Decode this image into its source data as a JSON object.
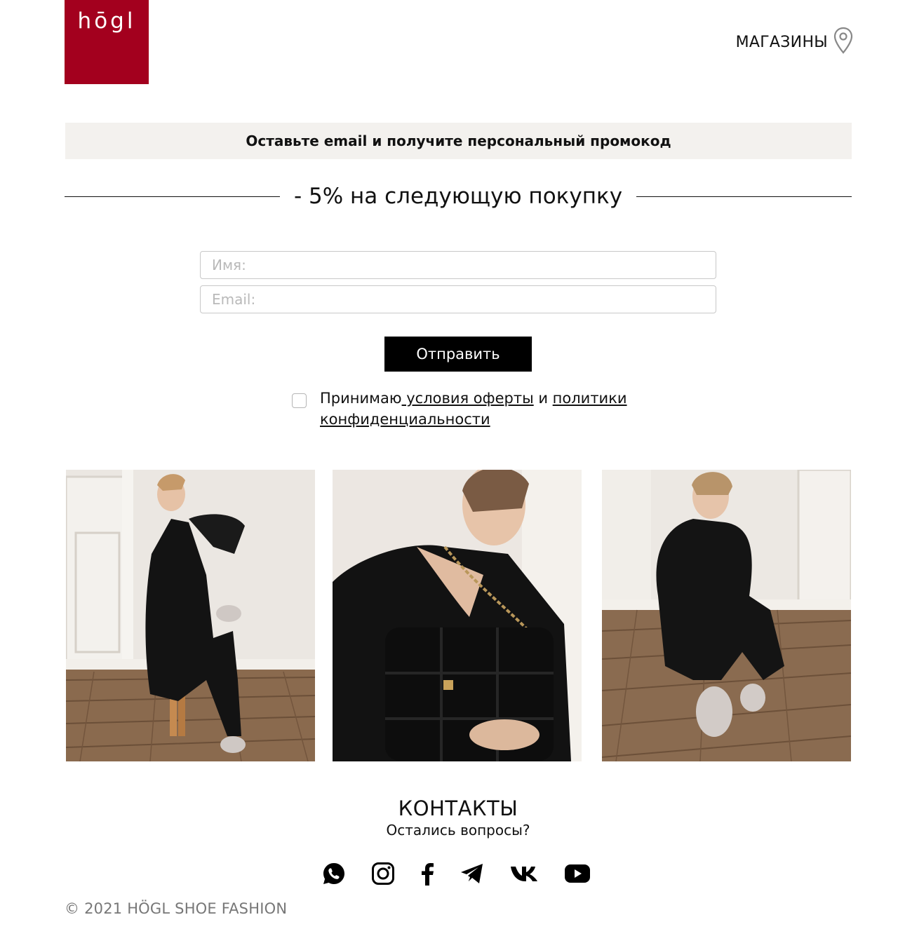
{
  "header": {
    "logo_text": "hōgl",
    "stores_label": "МАГАЗИНЫ",
    "stores_icon": "map-pin-icon"
  },
  "banner": {
    "text": "Оставьте email и получите персональный промокод"
  },
  "promo": {
    "text": "- 5% на следующую покупку"
  },
  "form": {
    "name_placeholder": "Имя:",
    "name_value": "",
    "email_placeholder": "Email:",
    "email_value": "",
    "submit_label": "Отправить",
    "consent": {
      "checked": false,
      "prefix": "Принимаю",
      "offer_link": " условия оферты",
      "middle": " и ",
      "privacy_link": "политики конфиденциальности"
    }
  },
  "gallery": {
    "photos": [
      {
        "name": "photo-woman-on-stool"
      },
      {
        "name": "photo-woman-with-bag"
      },
      {
        "name": "photo-woman-sitting-floor"
      }
    ]
  },
  "contacts": {
    "title": "КОНТАКТЫ",
    "subtitle": "Остались вопросы?",
    "social_icons": [
      "whatsapp-icon",
      "instagram-icon",
      "facebook-icon",
      "telegram-icon",
      "vk-icon",
      "youtube-icon"
    ]
  },
  "footer": {
    "copyright": "© 2021 HÖGL SHOE FASHION"
  },
  "colors": {
    "brand": "#a3001e",
    "banner_bg": "#f3f1ee",
    "button_bg": "#000000",
    "placeholder": "#b9b9b9",
    "footer_text": "#777777"
  }
}
